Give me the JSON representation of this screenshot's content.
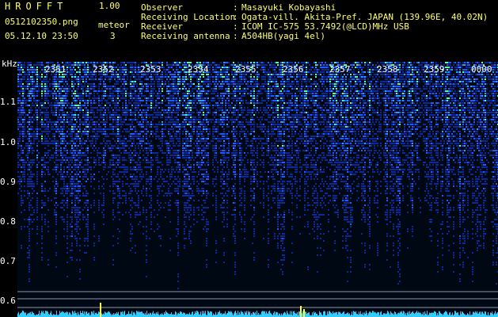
{
  "header": {
    "brand": "HROFFT",
    "version": "1.00",
    "filename": "0512102350.png",
    "datetime": "05.12.10 23:50",
    "meteor_label": "meteor",
    "meteor_count": "3"
  },
  "info": [
    {
      "label": "Observer",
      "value": "Masayuki Kobayashi"
    },
    {
      "label": "Receiving Location",
      "value": "Ogata-vill. Akita-Pref. JAPAN (139.96E, 40.02N)"
    },
    {
      "label": "Receiver",
      "value": "ICOM IC-575 53.7492(@LCD)MHz USB"
    },
    {
      "label": "Receiving antenna",
      "value": "A504HB(yagi 4el)"
    }
  ],
  "spectrogram": {
    "y_unit": "kHz",
    "y_ticks": [
      "1.1",
      "1.0",
      "0.9",
      "0.8",
      "0.7",
      "0.6"
    ],
    "x_ticks": [
      "2351",
      "2352",
      "2353",
      "2354",
      "2355",
      "2356",
      "2357",
      "2358",
      "2359",
      "0000"
    ],
    "colors": {
      "background": "#000000",
      "noise_low": "#001a66",
      "noise_mid": "#1a4dff",
      "noise_high": "#33ff99",
      "signal": "#ffff33",
      "baseline": "#33ccff"
    }
  }
}
